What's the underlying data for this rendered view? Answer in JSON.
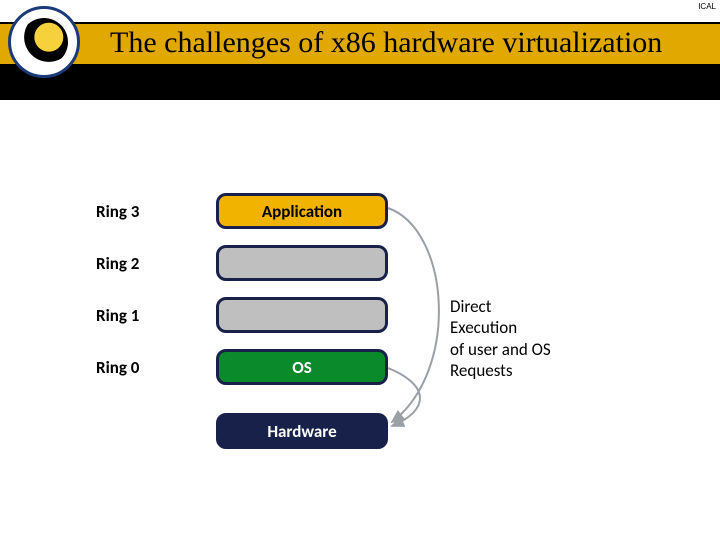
{
  "header": {
    "title": "The challenges of x86 hardware virtualization",
    "corner_label": "ICAL"
  },
  "rows": {
    "r3": {
      "label": "Ring 3",
      "box": "Application"
    },
    "r2": {
      "label": "Ring 2",
      "box": ""
    },
    "r1": {
      "label": "Ring 1",
      "box": ""
    },
    "r0": {
      "label": "Ring 0",
      "box": "OS"
    },
    "hw": {
      "box": "Hardware"
    }
  },
  "annotation": "Direct\nExecution\nof user and OS\nRequests"
}
